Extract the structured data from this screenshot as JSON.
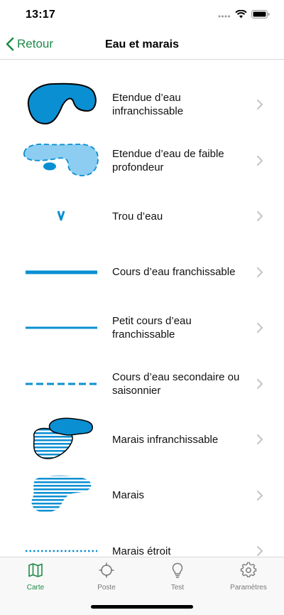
{
  "status_bar": {
    "time": "13:17"
  },
  "nav": {
    "back_label": "Retour",
    "title": "Eau et marais"
  },
  "colors": {
    "accent": "#1e8a48",
    "water_dark": "#0a8fd2",
    "water_light": "#8dcdf2",
    "stripe": "#0a8fd2",
    "chevron": "#c4c4c8"
  },
  "items": [
    {
      "label": "Etendue d’eau infranchissable",
      "icon": "deep-water-symbol"
    },
    {
      "label": "Etendue d’eau de faible profondeur",
      "icon": "shallow-water-symbol"
    },
    {
      "label": "Trou d’eau",
      "icon": "water-hole-symbol"
    },
    {
      "label": "Cours d’eau franchissable",
      "icon": "stream-thick-symbol"
    },
    {
      "label": "Petit cours d’eau franchissable",
      "icon": "stream-thin-symbol"
    },
    {
      "label": "Cours d’eau secondaire ou saisonnier",
      "icon": "seasonal-stream-symbol"
    },
    {
      "label": "Marais infranchissable",
      "icon": "impassable-marsh-symbol"
    },
    {
      "label": "Marais",
      "icon": "marsh-symbol"
    },
    {
      "label": "Marais étroit",
      "icon": "narrow-marsh-symbol"
    }
  ],
  "tabs": [
    {
      "label": "Carte",
      "icon": "map-icon",
      "active": true
    },
    {
      "label": "Poste",
      "icon": "crosshair-icon",
      "active": false
    },
    {
      "label": "Test",
      "icon": "lightbulb-icon",
      "active": false
    },
    {
      "label": "Paramètres",
      "icon": "gear-icon",
      "active": false
    }
  ]
}
